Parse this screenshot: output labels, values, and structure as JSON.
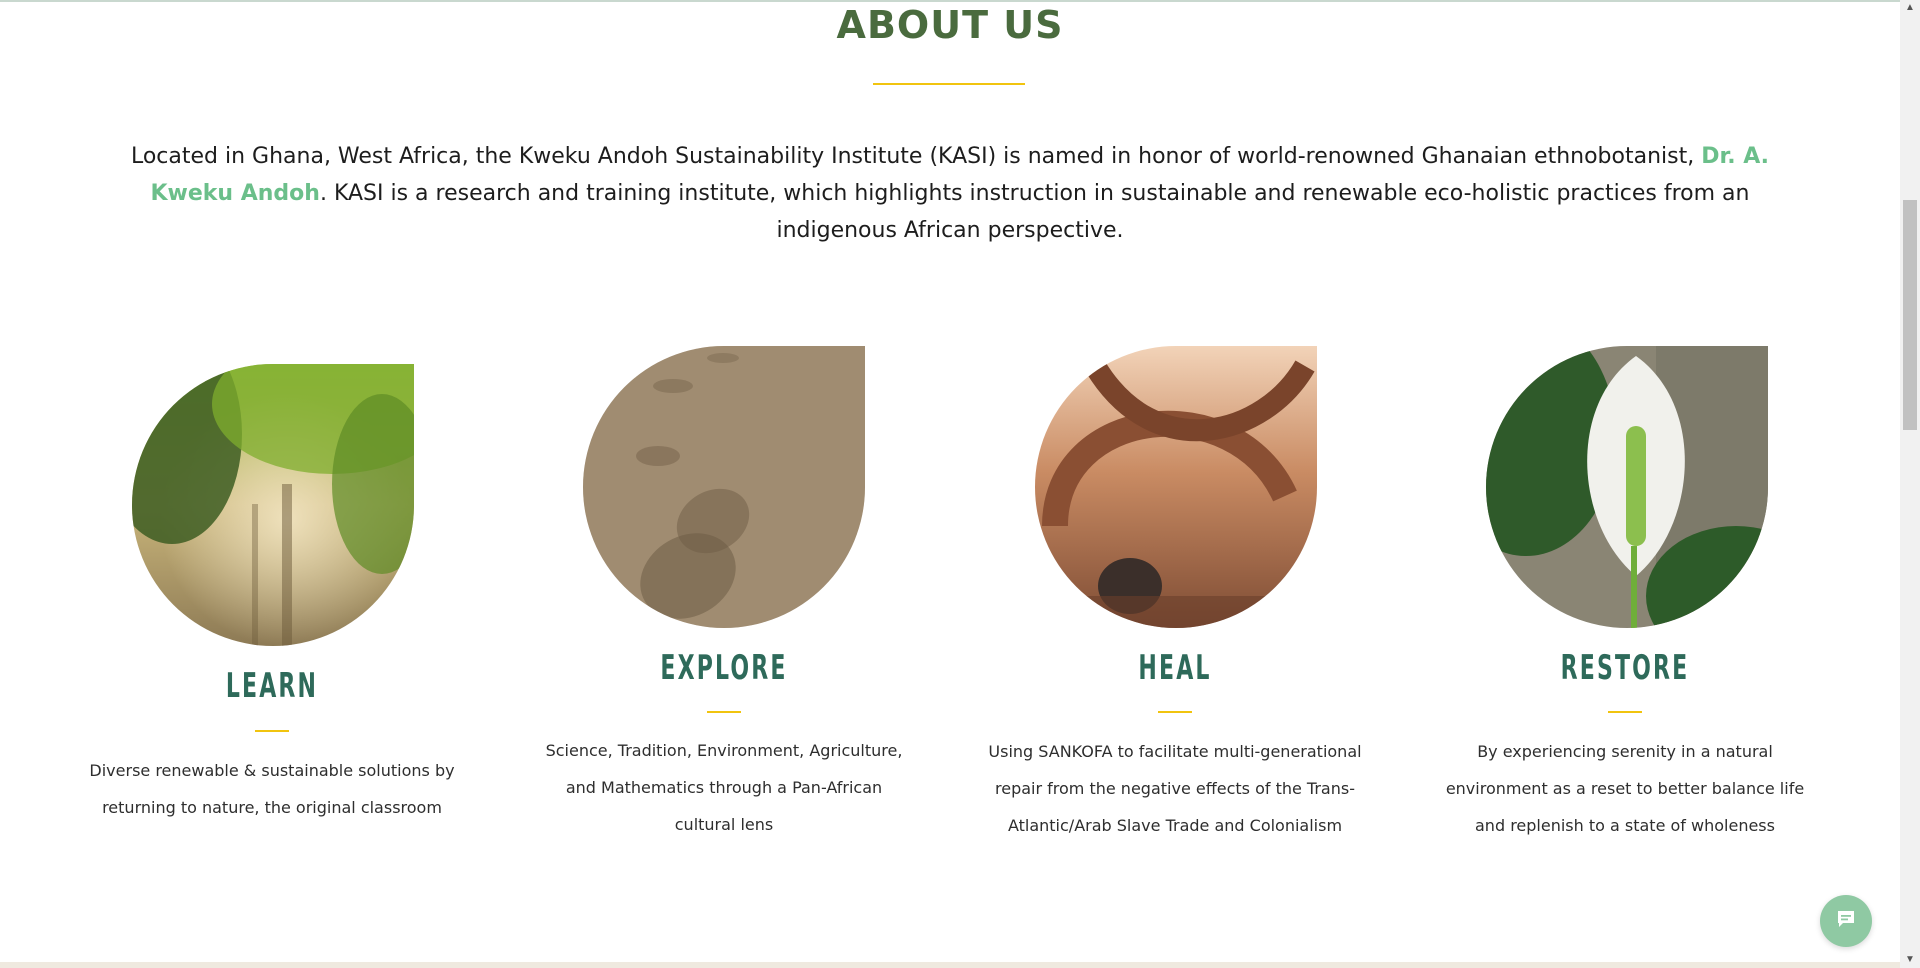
{
  "about": {
    "title": "ABOUT US",
    "intro_part1": "Located in Ghana, West Africa, the Kweku Andoh Sustainability Institute (KASI) is named in honor of world-renowned Ghanaian ethnobotanist, ",
    "intro_link": "Dr. A. Kweku Andoh",
    "intro_part2": ". KASI is a research and training institute, which highlights instruction in sustainable and renewable eco-holistic practices from an indigenous African perspective."
  },
  "cards": [
    {
      "title": "LEARN",
      "description": "Diverse renewable & sustainable solutions by returning to nature, the original classroom"
    },
    {
      "title": "EXPLORE",
      "description": "Science, Tradition, Environment, Agriculture, and Mathematics through a Pan-African cultural lens"
    },
    {
      "title": "HEAL",
      "description": "Using SANKOFA to facilitate multi-generational repair from the negative effects of the Trans-Atlantic/Arab Slave Trade and Colonialism"
    },
    {
      "title": "RESTORE",
      "description": "By experiencing serenity in a natural environment as a reset to better balance life and replenish to a state of wholeness"
    }
  ],
  "colors": {
    "heading": "#4a6b3e",
    "accent_link": "#6bbf8a",
    "rule": "#f1c40f",
    "card_title": "#2e6a5a"
  },
  "icons": {
    "chat": "chat-bubble-icon"
  }
}
